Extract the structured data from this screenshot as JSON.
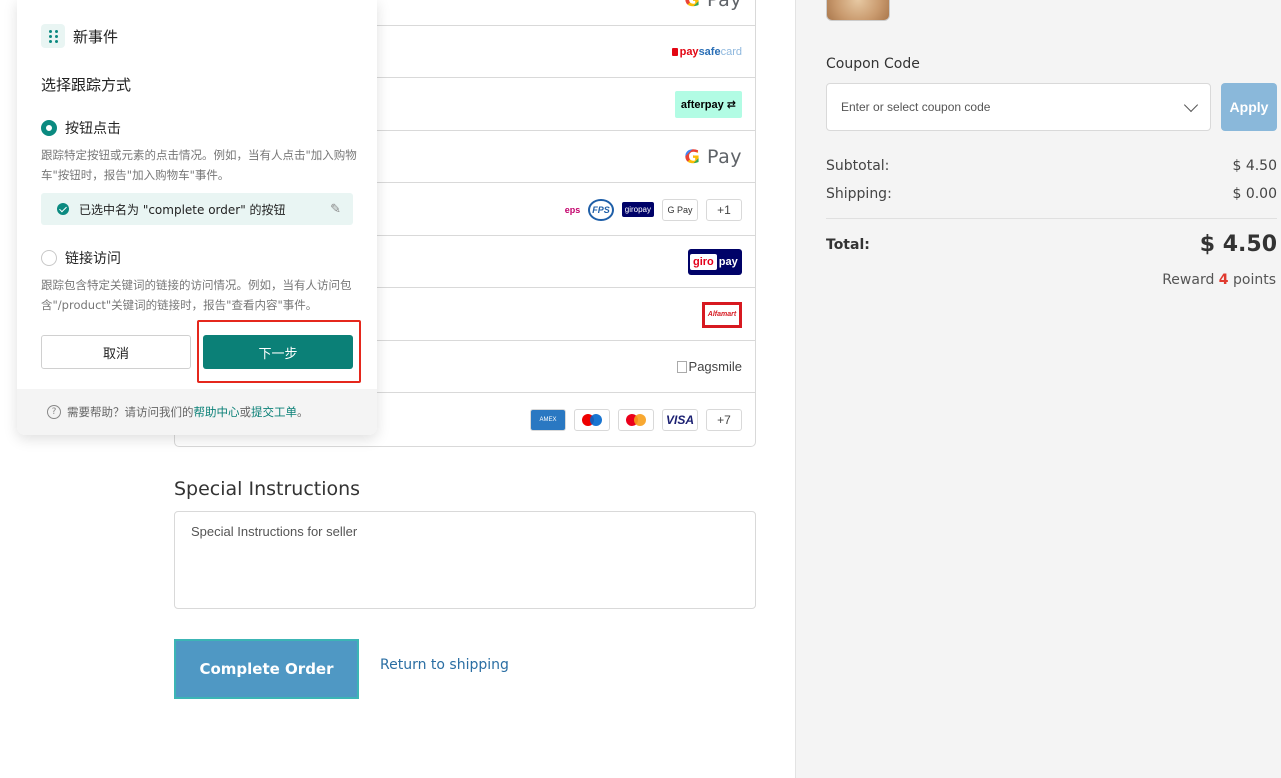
{
  "payments": {
    "row0": {
      "gpay": "Pay"
    },
    "row1": {
      "paysafe_a": "pay",
      "paysafe_b": "safe",
      "paysafe_c": "card"
    },
    "row2": {
      "afterpay": "afterpay"
    },
    "row3": {
      "gpay": "Pay"
    },
    "row4": {
      "chips": [
        "eps",
        "FPS",
        "giropay",
        "G Pay"
      ],
      "more": "+1"
    },
    "row5": {
      "giro_a": "giro",
      "giro_b": "pay"
    },
    "row6": {
      "alfa": "Alfamart"
    },
    "row7": {
      "pagsmile": "Pagsmile"
    },
    "row8": {
      "cards": [
        "AMEX",
        "Maestro",
        "Mastercard",
        "VISA"
      ],
      "more": "+7"
    }
  },
  "special": {
    "title": "Special Instructions",
    "placeholder": "Special Instructions for seller"
  },
  "actions": {
    "complete": "Complete Order",
    "return": "Return to shipping"
  },
  "sidebar": {
    "coupon_label": "Coupon Code",
    "coupon_placeholder": "Enter or select coupon code",
    "apply": "Apply",
    "subtotal_label": "Subtotal:",
    "subtotal_value": "$ 4.50",
    "shipping_label": "Shipping:",
    "shipping_value": "$ 0.00",
    "total_label": "Total:",
    "total_value": "$ 4.50",
    "reward_prefix": "Reward",
    "reward_points": "4",
    "reward_suffix": "points"
  },
  "panel": {
    "title": "新事件",
    "section_title": "选择跟踪方式",
    "option_click": "按钮点击",
    "option_click_desc": "跟踪特定按钮或元素的点击情况。例如，当有人点击\"加入购物车\"按钮时，报告\"加入购物车\"事件。",
    "selected_text": "已选中名为 \"complete order\" 的按钮",
    "option_link": "链接访问",
    "option_link_desc": "跟踪包含特定关键词的链接的访问情况。例如，当有人访问包含\"/product\"关键词的链接时，报告\"查看内容\"事件。",
    "cancel": "取消",
    "next": "下一步",
    "help_prefix": "需要帮助？请访问我们的",
    "help_center": "帮助中心",
    "help_or": "或",
    "submit_ticket": "提交工单",
    "help_end": "。"
  }
}
